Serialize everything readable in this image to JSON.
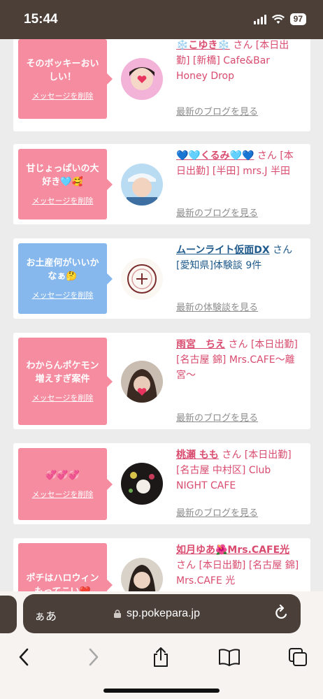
{
  "status": {
    "time": "15:44",
    "battery": "97"
  },
  "browser": {
    "text_size": "ぁあ",
    "url": "sp.pokepara.jp"
  },
  "cards": [
    {
      "bubble": "そのボッキーおいしい！",
      "delete": "メッセージを削除",
      "name": "❄️こゆき❄️",
      "san": "さん",
      "detail": "[本日出勤] [新橋] Cafe&Bar Honey Drop",
      "link": "最新のブログを見る"
    },
    {
      "bubble": "甘じょっぱいの大好き🩵🥰",
      "delete": "メッセージを削除",
      "name": "💙🩵くるみ🩵💙",
      "san": "さん",
      "detail": "[本日出勤] [半田] mrs.J 半田",
      "link": "最新のブログを見る"
    },
    {
      "bubble": "お土産何がいいかなぁ🤔",
      "delete": "メッセージを削除",
      "name": "ムーンライト仮面DX",
      "san": "さん",
      "detail": "[愛知県]体験談 9件",
      "link": "最新の体験談を見る"
    },
    {
      "bubble": "わからんポケモン増えすぎ案件",
      "delete": "メッセージを削除",
      "name": "雨宮　ちえ",
      "san": "さん",
      "detail": "[本日出勤] [名古屋 錦] Mrs.CAFE～離宮～",
      "link": "最新のブログを見る"
    },
    {
      "bubble": "💞💞💞",
      "delete": "メッセージを削除",
      "name": "桃瀬 もも",
      "san": "さん",
      "detail": "[本日出勤] [名古屋 中村区] Club NIGHT CAFE",
      "link": "最新のブログを見る"
    },
    {
      "bubble": "ポチはハロウィンもってこい❤️",
      "delete": "",
      "name": "如月ゆあ🌺Mrs.CAFE光",
      "san": "さん",
      "detail": "[本日出勤] [名古屋 錦] Mrs.CAFE 光",
      "link": ""
    }
  ],
  "colors": {
    "pink_bubble": "#f58ca0",
    "blue_bubble": "#86b8ee",
    "name_pink": "#d94b6e",
    "name_blue": "#1f5a8c"
  }
}
